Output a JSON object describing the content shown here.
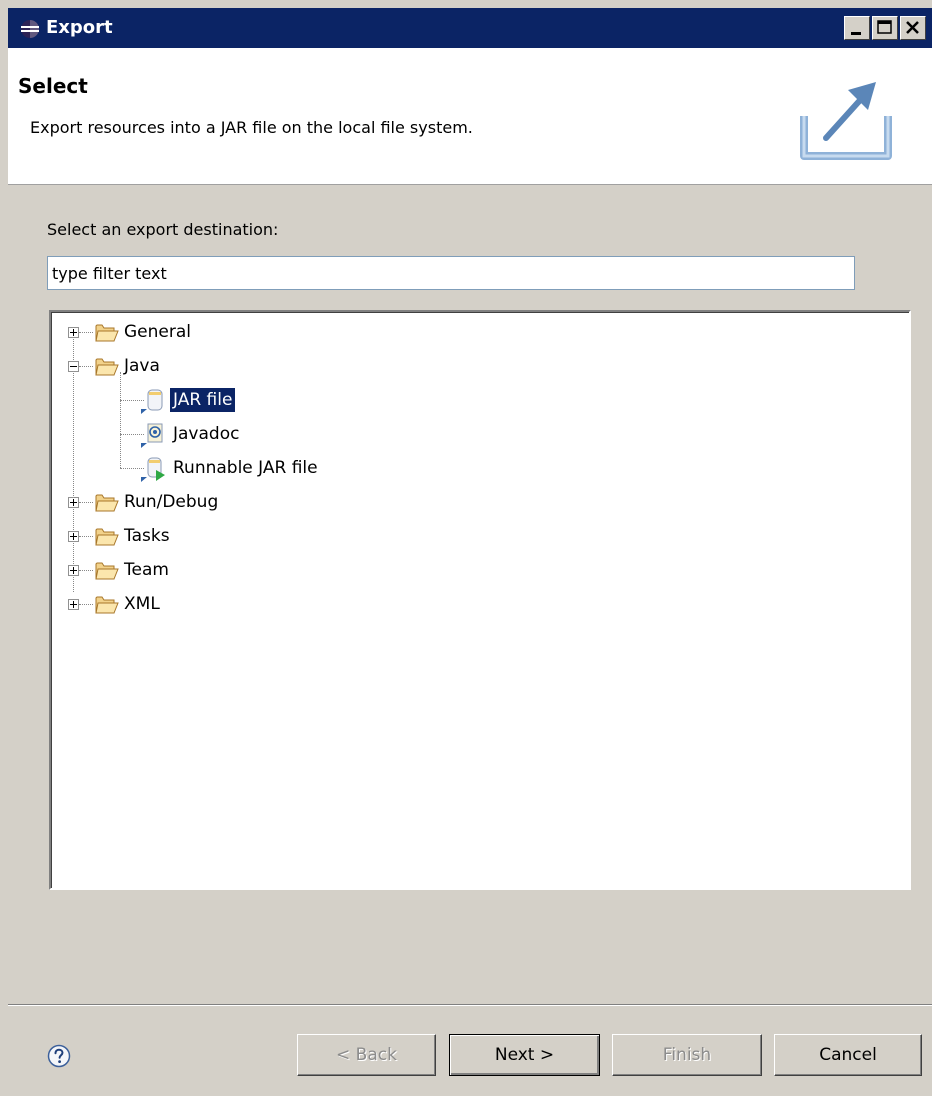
{
  "window": {
    "title": "Export"
  },
  "header": {
    "title": "Select",
    "description": "Export resources into a JAR file on the local file system."
  },
  "filter": {
    "label": "Select an export destination:",
    "value": "type filter text"
  },
  "tree": {
    "items": [
      {
        "label": "General",
        "expanded": false
      },
      {
        "label": "Java",
        "expanded": true
      },
      {
        "label": "JAR file",
        "selected": true
      },
      {
        "label": "Javadoc"
      },
      {
        "label": "Runnable JAR file"
      },
      {
        "label": "Run/Debug",
        "expanded": false
      },
      {
        "label": "Tasks",
        "expanded": false
      },
      {
        "label": "Team",
        "expanded": false
      },
      {
        "label": "XML",
        "expanded": false
      }
    ]
  },
  "buttons": {
    "back": "< Back",
    "next": "Next >",
    "finish": "Finish",
    "cancel": "Cancel"
  },
  "icons": {
    "app": "eclipse-icon",
    "export": "export-icon",
    "help": "help-icon",
    "folder": "folder-icon",
    "jar": "jar-icon",
    "javadoc": "javadoc-icon",
    "runnable_jar": "runnable-jar-icon"
  },
  "colors": {
    "titlebar": "#0b2465",
    "selection": "#0b2465",
    "dialog_bg": "#d4d0c8"
  }
}
